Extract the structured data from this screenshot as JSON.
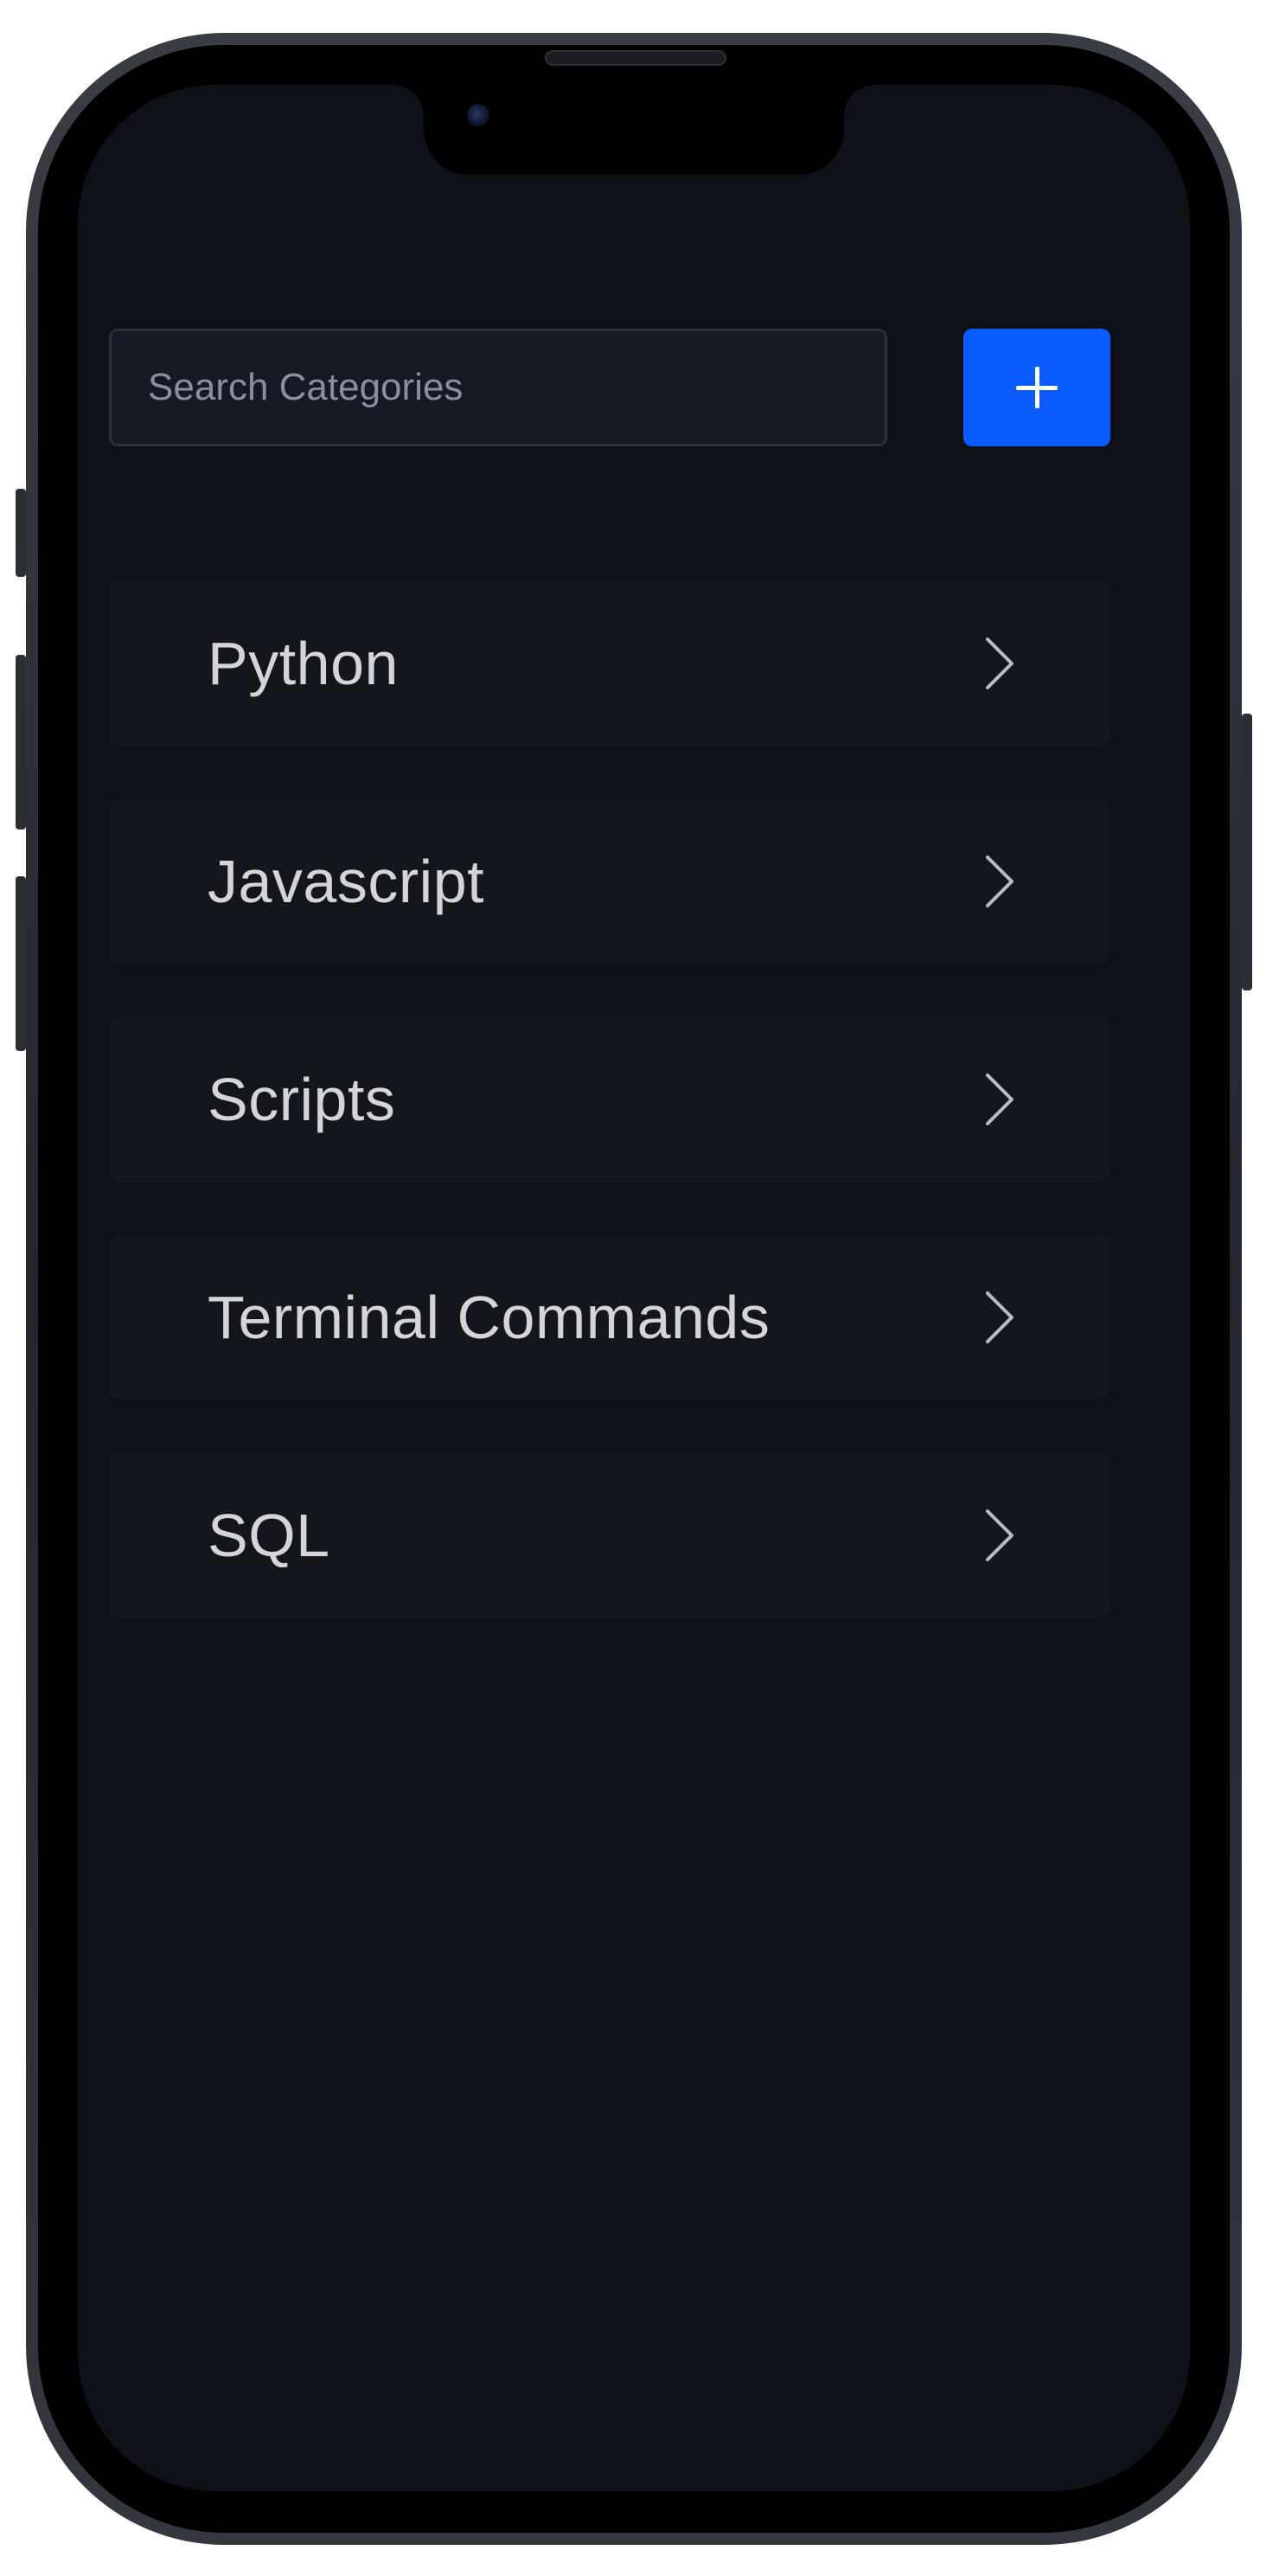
{
  "search": {
    "placeholder": "Search Categories",
    "value": ""
  },
  "add_button": {
    "icon": "plus-icon"
  },
  "categories": [
    {
      "label": "Python"
    },
    {
      "label": "Javascript"
    },
    {
      "label": "Scripts"
    },
    {
      "label": "Terminal Commands"
    },
    {
      "label": "SQL"
    }
  ],
  "colors": {
    "background": "#0f1118",
    "accent": "#0b5cff",
    "item_background": "#14161d",
    "text": "#d3d5da"
  }
}
